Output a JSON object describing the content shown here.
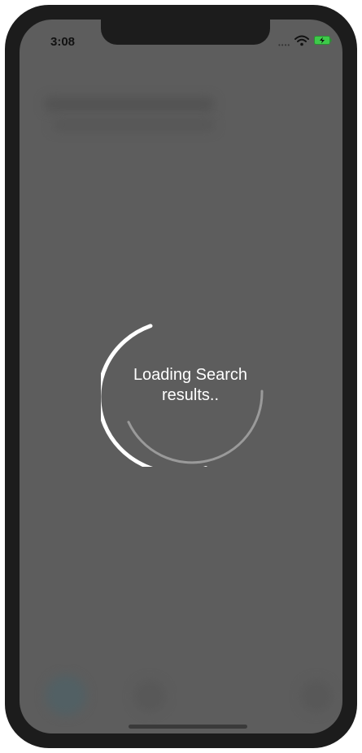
{
  "status_bar": {
    "time": "3:08",
    "signal_icon": "signal-dots-icon",
    "wifi_icon": "wifi-icon",
    "battery_icon": "battery-charging-icon"
  },
  "overlay": {
    "loading_line_1": "Loading Search",
    "loading_line_2": "results.."
  },
  "colors": {
    "device_frame": "#1c1c1c",
    "overlay": "#5d5d5d",
    "spinner_primary": "#ffffff",
    "spinner_track": "#9a9a9a",
    "battery": "#3ec94a"
  }
}
